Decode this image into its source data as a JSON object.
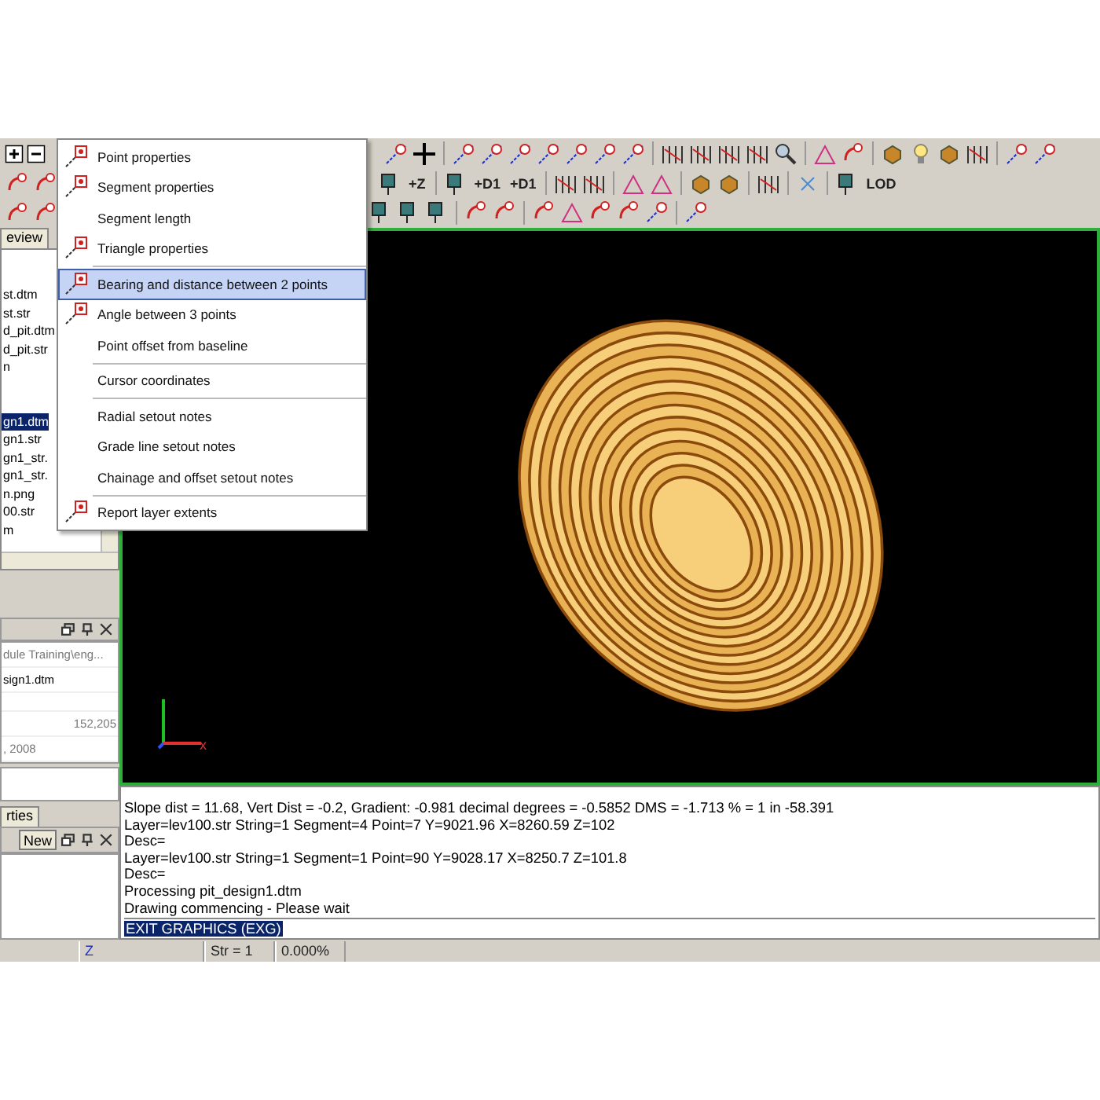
{
  "left_panel": {
    "tab": "eview",
    "files": [
      {
        "name": "st.dtm",
        "selected": false
      },
      {
        "name": "st.str",
        "selected": false
      },
      {
        "name": "d_pit.dtm",
        "selected": false
      },
      {
        "name": "d_pit.str",
        "selected": false
      },
      {
        "name": "n",
        "selected": false
      },
      {
        "name": "gn1.dtm",
        "selected": true
      },
      {
        "name": "gn1.str",
        "selected": false
      },
      {
        "name": "gn1_str.",
        "selected": false
      },
      {
        "name": "gn1_str.",
        "selected": false
      },
      {
        "name": "n.png",
        "selected": false
      },
      {
        "name": "00.str",
        "selected": false
      },
      {
        "name": "m",
        "selected": false
      }
    ],
    "properties": [
      {
        "value": "dule Training\\eng...",
        "kind": "muted"
      },
      {
        "value": "sign1.dtm",
        "kind": "plain"
      },
      {
        "value": "152,205",
        "kind": "number"
      },
      {
        "value": ", 2008",
        "kind": "muted"
      }
    ],
    "bottom_tab": "rties",
    "new_button": "New"
  },
  "toolbar": {
    "labels": [
      "+Z",
      "+D1",
      "+D1",
      "LOD"
    ]
  },
  "menu": {
    "groups": [
      [
        {
          "label": "Point properties",
          "kind": "icon",
          "selected": false
        },
        {
          "label": "Segment properties",
          "kind": "icon",
          "selected": false
        },
        {
          "label": "Segment length",
          "kind": "plain",
          "selected": false
        },
        {
          "label": "Triangle properties",
          "kind": "icon",
          "selected": false
        }
      ],
      [
        {
          "label": "Bearing and distance between 2 points",
          "kind": "icon",
          "selected": true
        },
        {
          "label": "Angle between 3 points",
          "kind": "icon",
          "selected": false
        },
        {
          "label": "Point offset from baseline",
          "kind": "plain",
          "selected": false
        }
      ],
      [
        {
          "label": "Cursor coordinates",
          "kind": "plain",
          "selected": false
        }
      ],
      [
        {
          "label": "Radial setout notes",
          "kind": "plain",
          "selected": false
        },
        {
          "label": "Grade line setout notes",
          "kind": "plain",
          "selected": false
        },
        {
          "label": "Chainage and offset setout notes",
          "kind": "plain",
          "selected": false
        }
      ],
      [
        {
          "label": "Report layer extents",
          "kind": "icon",
          "selected": false
        }
      ]
    ]
  },
  "viewport": {
    "axis_label": "x"
  },
  "console": {
    "lines": [
      "Slope dist = 11.68, Vert Dist = -0.2, Gradient: -0.981 decimal degrees = -0.5852 DMS = -1.713 % = 1 in -58.391",
      "Layer=lev100.str String=1 Segment=4 Point=7 Y=9021.96 X=8260.59 Z=102",
      "Desc=",
      "Layer=lev100.str String=1 Segment=1 Point=90 Y=9028.17 X=8250.7 Z=101.8",
      "Desc=",
      "Processing pit_design1.dtm",
      "Drawing commencing - Please wait"
    ],
    "command": "EXIT GRAPHICS (EXG)"
  },
  "status_bar": {
    "fields": [
      "Z",
      "Str = 1",
      "0.000%"
    ]
  }
}
